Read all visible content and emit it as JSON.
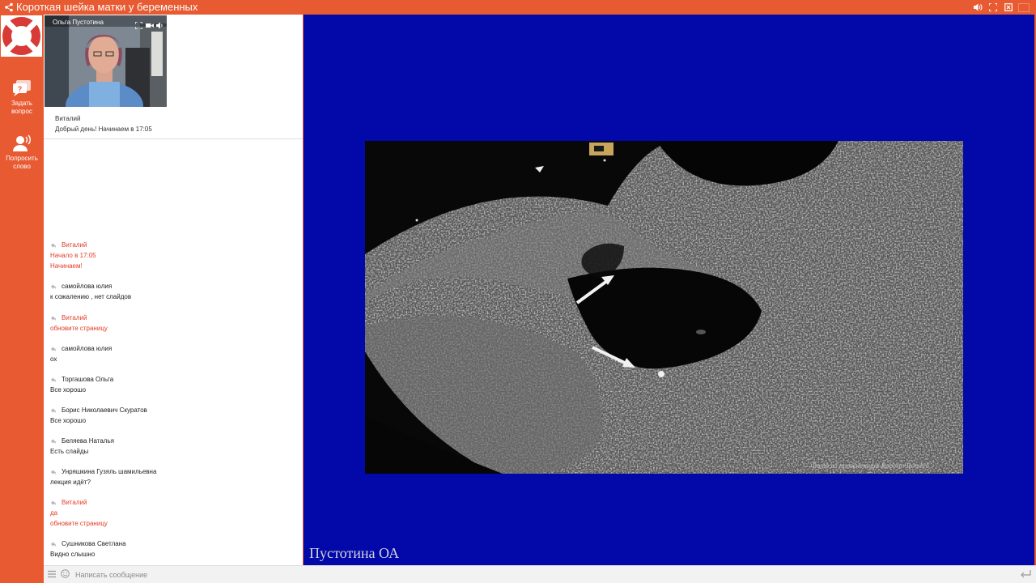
{
  "window": {
    "title": "Короткая шейка матки у беременных"
  },
  "colors": {
    "brand": "#e85a32",
    "stage_bg": "#0308a8",
    "highlight_text": "#e23c26"
  },
  "rail": {
    "ask_question": "Задать вопрос",
    "request_floor": "Попросить слово"
  },
  "video": {
    "presenter_name": "Ольга Пустотина"
  },
  "pinned": {
    "author": "Виталий",
    "text": "Добрый день! Начинаем в 17:05"
  },
  "chat": {
    "messages": [
      {
        "author": "Виталий",
        "lines": [
          "Начало в 17:05",
          "Начинаем!"
        ],
        "highlight": true
      },
      {
        "author": "самойлова юлия",
        "lines": [
          "к сожалению , нет слайдов"
        ],
        "highlight": false
      },
      {
        "author": "Виталий",
        "lines": [
          "обновите страницу"
        ],
        "highlight": true
      },
      {
        "author": "самойлова юлия",
        "lines": [
          "ох"
        ],
        "highlight": false
      },
      {
        "author": "Торгашова Ольга",
        "lines": [
          "Все хорошо"
        ],
        "highlight": false
      },
      {
        "author": "Борис Николаевич Скуратов",
        "lines": [
          "Все хорошо"
        ],
        "highlight": false
      },
      {
        "author": "Беляева Наталья",
        "lines": [
          "Есть слайды"
        ],
        "highlight": false
      },
      {
        "author": "Унряшкина Гузяль шамильевна",
        "lines": [
          "лекция идёт?"
        ],
        "highlight": false
      },
      {
        "author": "Виталий",
        "lines": [
          "да",
          "обновите страницу"
        ],
        "highlight": true
      },
      {
        "author": "Сушникова Светлана",
        "lines": [
          "Видно слышно"
        ],
        "highlight": false
      }
    ]
  },
  "slide": {
    "caption": "Пустотина ОА",
    "photo_credit": "Фото из презентации Roberto Romero"
  },
  "composer": {
    "placeholder": "Написать сообщение"
  },
  "icons": [
    "share-icon",
    "volume-icon",
    "fullscreen-icon",
    "exit-icon",
    "russian-flag-icon",
    "question-bubble-icon",
    "speaker-person-icon",
    "reply-icon",
    "menu-icon",
    "emoji-icon",
    "send-icon",
    "camera-icon",
    "fullscreen-small-icon",
    "sound-icon"
  ]
}
